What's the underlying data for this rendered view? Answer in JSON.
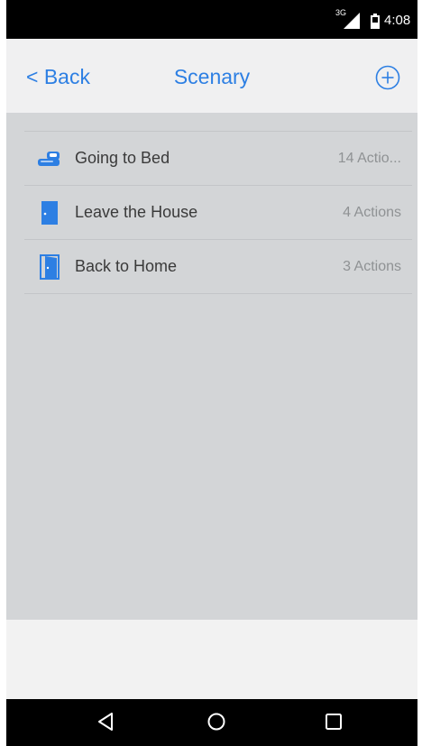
{
  "status_bar": {
    "network": "3G",
    "time": "4:08"
  },
  "header": {
    "back_label": "< Back",
    "title": "Scenary"
  },
  "scenes": [
    {
      "name": "Going to Bed",
      "count": "14 Actio...",
      "icon": "bed-icon"
    },
    {
      "name": "Leave the House",
      "count": "4 Actions",
      "icon": "door-icon"
    },
    {
      "name": "Back to Home",
      "count": "3 Actions",
      "icon": "open-door-icon"
    }
  ],
  "colors": {
    "accent": "#2d7fe3",
    "background": "#d3d5d7",
    "header_bg": "#f0f0f1"
  }
}
